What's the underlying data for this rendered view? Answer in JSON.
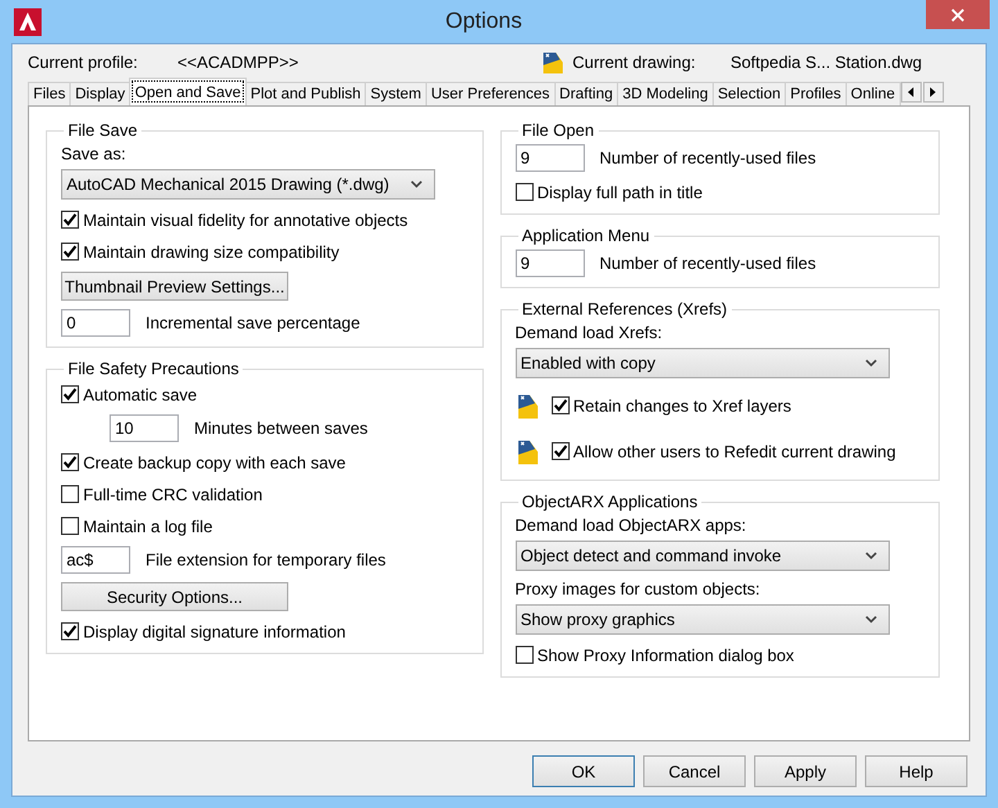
{
  "window": {
    "title": "Options"
  },
  "profile": {
    "label": "Current profile:",
    "value": "<<ACADMPP>>"
  },
  "drawing": {
    "label": "Current drawing:",
    "value": "Softpedia S... Station.dwg"
  },
  "tabs": [
    {
      "label": "Files",
      "selected": false
    },
    {
      "label": "Display",
      "selected": false
    },
    {
      "label": "Open and Save",
      "selected": true
    },
    {
      "label": "Plot and Publish",
      "selected": false
    },
    {
      "label": "System",
      "selected": false
    },
    {
      "label": "User Preferences",
      "selected": false
    },
    {
      "label": "Drafting",
      "selected": false
    },
    {
      "label": "3D Modeling",
      "selected": false
    },
    {
      "label": "Selection",
      "selected": false
    },
    {
      "label": "Profiles",
      "selected": false
    },
    {
      "label": "Online",
      "selected": false
    }
  ],
  "left_groups": [
    {
      "title": "File Save",
      "items": [
        {
          "kind": "label",
          "text": "Save as:"
        },
        {
          "kind": "select",
          "value": "AutoCAD Mechanical 2015 Drawing (*.dwg)"
        },
        {
          "kind": "checkbox",
          "text": "Maintain visual fidelity for annotative objects",
          "checked": true
        },
        {
          "kind": "checkbox",
          "text": "Maintain drawing size compatibility",
          "checked": true
        },
        {
          "kind": "button",
          "text": "Thumbnail Preview Settings..."
        },
        {
          "kind": "number",
          "value": "0",
          "text": "Incremental save percentage"
        }
      ]
    },
    {
      "title": "File Safety Precautions",
      "items": [
        {
          "kind": "checkbox",
          "text": "Automatic save",
          "checked": true
        },
        {
          "kind": "indented-number",
          "value": "10",
          "text": "Minutes between saves"
        },
        {
          "kind": "checkbox",
          "text": "Create backup copy with each save",
          "checked": true
        },
        {
          "kind": "checkbox",
          "text": "Full-time CRC validation",
          "checked": false
        },
        {
          "kind": "checkbox",
          "text": "Maintain a log file",
          "checked": false
        },
        {
          "kind": "number",
          "value": "ac$",
          "text": "File extension for temporary files"
        },
        {
          "kind": "button",
          "text": "Security Options..."
        },
        {
          "kind": "checkbox",
          "text": "Display digital signature information",
          "checked": true
        }
      ]
    }
  ],
  "right_groups": [
    {
      "title": "File Open",
      "items": [
        {
          "kind": "number",
          "value": "9",
          "text": "Number of recently-used files"
        },
        {
          "kind": "checkbox",
          "text": "Display full path in title",
          "checked": false
        }
      ]
    },
    {
      "title": "Application Menu",
      "items": [
        {
          "kind": "number",
          "value": "9",
          "text": "Number of recently-used files"
        }
      ]
    },
    {
      "title": "External References (Xrefs)",
      "items": [
        {
          "kind": "label",
          "text": "Demand load Xrefs:"
        },
        {
          "kind": "select",
          "value": "Enabled with copy"
        },
        {
          "kind": "icon-checkbox",
          "text": "Retain changes to Xref layers",
          "checked": true
        },
        {
          "kind": "icon-checkbox",
          "text": "Allow other users to Refedit current drawing",
          "checked": true
        }
      ]
    },
    {
      "title": "ObjectARX Applications",
      "items": [
        {
          "kind": "label",
          "text": "Demand load ObjectARX apps:"
        },
        {
          "kind": "select",
          "value": "Object detect and command invoke"
        },
        {
          "kind": "label",
          "text": "Proxy images for custom objects:"
        },
        {
          "kind": "select",
          "value": "Show proxy graphics"
        },
        {
          "kind": "checkbox",
          "text": "Show Proxy Information dialog box",
          "checked": false
        }
      ]
    }
  ],
  "buttons": [
    {
      "label": "OK",
      "default": true
    },
    {
      "label": "Cancel",
      "default": false
    },
    {
      "label": "Apply",
      "default": false
    },
    {
      "label": "Help",
      "default": false
    }
  ]
}
